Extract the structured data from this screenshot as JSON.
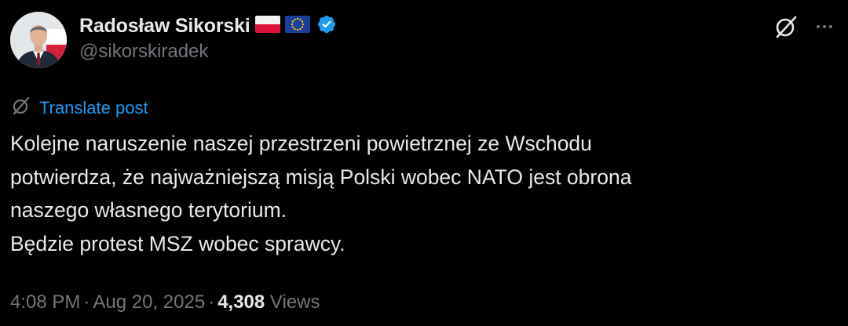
{
  "author": {
    "display_name": "Radosław Sikorski",
    "handle": "@sikorskiradek",
    "flags": [
      "poland-flag-icon",
      "eu-flag-icon"
    ],
    "verified": true,
    "verified_color": "#1d9bf0"
  },
  "header_actions": {
    "grok_icon": "grok-icon",
    "more_icon": "more-options-icon"
  },
  "translate": {
    "label": "Translate post",
    "icon": "translate-icon",
    "color": "#1d9bf0"
  },
  "post": {
    "lines": [
      "Kolejne naruszenie naszej przestrzeni powietrznej ze Wschodu",
      "potwierdza, że najważniejszą misją Polski wobec NATO jest obrona",
      "naszego własnego terytorium.",
      "Będzie protest MSZ wobec sprawcy."
    ]
  },
  "meta": {
    "time": "4:08 PM",
    "separator": "·",
    "date": "Aug 20, 2025",
    "views_count": "4,308",
    "views_label": "Views"
  },
  "colors": {
    "background": "#000000",
    "text_primary": "#e7e9ea",
    "text_secondary": "#71767b",
    "accent": "#1d9bf0"
  }
}
